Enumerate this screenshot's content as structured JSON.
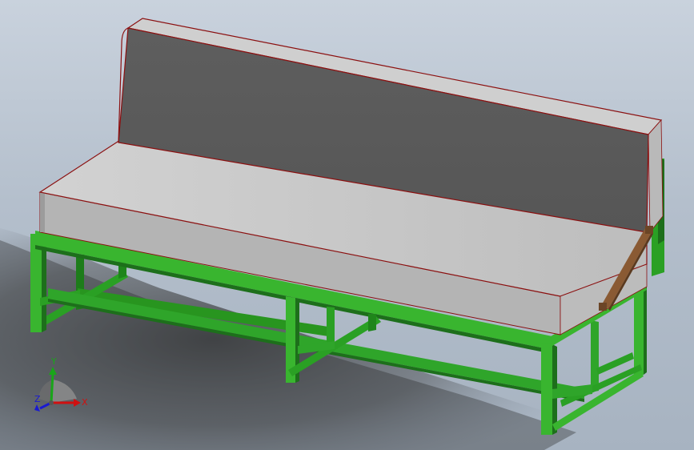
{
  "viewport": {
    "background_top": "#c9d2dd",
    "background_bottom": "#a7b3c1"
  },
  "model": {
    "frame_color": "#2fa52a",
    "frame_dark": "#1d6f1b",
    "cushion_top": "#c6c6c6",
    "cushion_side": "#a9a9a9",
    "backrest_face": "#5a5a5a",
    "edge_color": "#8b1010",
    "strut_color": "#8a5a33"
  },
  "triad": {
    "x_label": "X",
    "y_label": "Y",
    "z_label": "Z",
    "x_color": "#d01010",
    "y_color": "#19a519",
    "z_color": "#1a1ad0"
  }
}
